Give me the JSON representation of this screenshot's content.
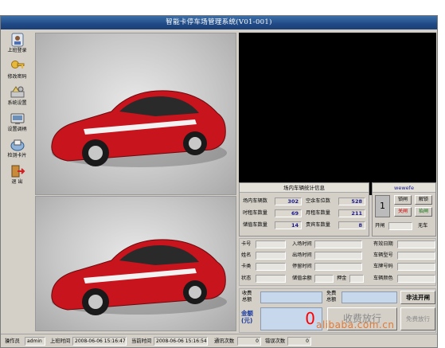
{
  "window": {
    "title": "智能卡停车场管理系统(V01-001)"
  },
  "sidebar": {
    "items": [
      {
        "label": "上班登录",
        "icon": "id-card-icon"
      },
      {
        "label": "修改密码",
        "icon": "key-icon"
      },
      {
        "label": "系统设置",
        "icon": "gear-icon"
      },
      {
        "label": "设置调柄",
        "icon": "device-icon"
      },
      {
        "label": "检测卡片",
        "icon": "card-reader-icon"
      },
      {
        "label": "退  出",
        "icon": "exit-icon"
      }
    ]
  },
  "stats": {
    "title": "场内车辆统计信息",
    "rows": [
      {
        "l1": "场内车辆数",
        "v1": "302",
        "l2": "空余车位数",
        "v2": "528"
      },
      {
        "l1": "时租车数量",
        "v1": "69",
        "l2": "月租车数量",
        "v2": "211"
      },
      {
        "l1": "储值车数量",
        "v1": "14",
        "l2": "贵宾车数量",
        "v2": "8"
      }
    ]
  },
  "gate": {
    "title": "wewefe",
    "number": "1",
    "btn_open_lock": "锁闸",
    "btn_unlock": "解锁",
    "btn_close": "关闸",
    "btn_lift": "抬闸",
    "lbl_open": "开闸",
    "lbl_nocar": "无车"
  },
  "info": {
    "row1": [
      "卡号",
      "入场时间",
      "有效日期"
    ],
    "row2": [
      "姓名",
      "出场时间",
      "车辆型号"
    ],
    "row3": [
      "卡类",
      "停留时间",
      "车牌号码"
    ],
    "row4": [
      "状态",
      "储值余额",
      "押金",
      "车辆颜色"
    ]
  },
  "fee": {
    "label_total": "收费\n总额",
    "label_free": "免费\n总额",
    "btn_illegal": "非法开闸",
    "amount_label": "金额\n(元)",
    "amount": "0",
    "btn_collect": "收费放行",
    "btn_free": "免费放行"
  },
  "status": {
    "operator_label": "操作员",
    "operator": "admin",
    "shift_label": "上班时间",
    "shift": "2008-06-06 15:16:47",
    "now_label": "当前时间",
    "now": "2008-06-06 15:16:54",
    "comm_label": "通讯次数",
    "comm": "0",
    "err_label": "错误次数",
    "err": "0"
  },
  "watermark": "alibaba.com.cn",
  "colors": {
    "title": "#204a86",
    "value_text": "#1a1a8c",
    "amount": "#ff0000",
    "car": "#c8141c",
    "fee_input": "#c8d8ec"
  }
}
